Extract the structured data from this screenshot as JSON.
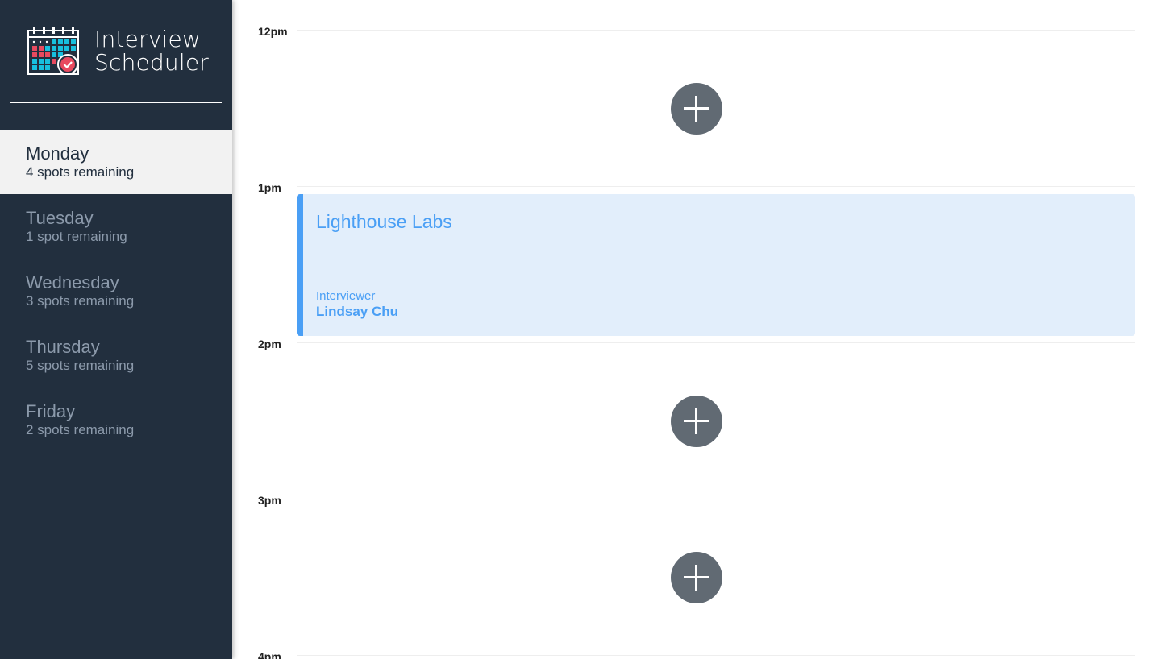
{
  "app": {
    "title_line1": "Interview",
    "title_line2": "Scheduler",
    "logo_icon": "calendar-check-icon"
  },
  "sidebar": {
    "days": [
      {
        "name": "Monday",
        "spots": "4 spots remaining",
        "selected": true
      },
      {
        "name": "Tuesday",
        "spots": "1 spot remaining",
        "selected": false
      },
      {
        "name": "Wednesday",
        "spots": "3 spots remaining",
        "selected": false
      },
      {
        "name": "Thursday",
        "spots": "5 spots remaining",
        "selected": false
      },
      {
        "name": "Friday",
        "spots": "2 spots remaining",
        "selected": false
      }
    ]
  },
  "schedule": {
    "slots": [
      {
        "time": "12pm",
        "state": "empty",
        "action_icon": "add-icon"
      },
      {
        "time": "1pm",
        "state": "booked"
      },
      {
        "time": "2pm",
        "state": "empty",
        "action_icon": "add-icon"
      },
      {
        "time": "3pm",
        "state": "empty",
        "action_icon": "add-icon"
      },
      {
        "time": "4pm",
        "state": "empty"
      }
    ],
    "appointment": {
      "student": "Lighthouse Labs",
      "interviewer_label": "Interviewer",
      "interviewer_name": "Lindsay Chu"
    }
  },
  "colors": {
    "sidebar_bg": "#222f3e",
    "selected_bg": "#f2f2f2",
    "accent_blue": "#4a9ff5",
    "appointment_bg": "#e2eefb",
    "add_button_bg": "#616a73"
  }
}
